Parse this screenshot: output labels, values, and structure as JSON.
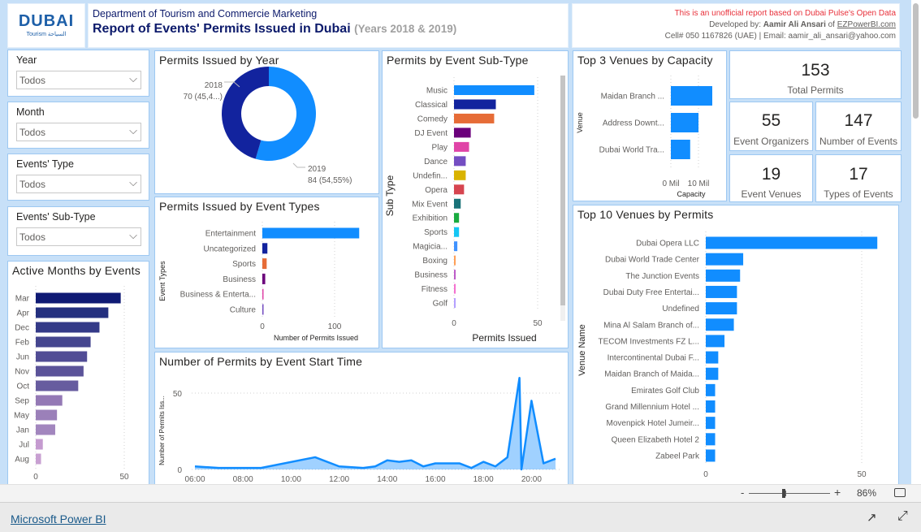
{
  "header": {
    "logo_text": "DUBAI",
    "logo_sub": "Tourism السياحة",
    "department": "Department of Tourism and Commercie Marketing",
    "title": "Report of Events' Permits Issued in Dubai",
    "years": "(Years 2018 & 2019)",
    "disclaimer": "This is an unofficial report based on Dubai Pulse's Open Data",
    "developed_prefix": "Developed by: ",
    "developer": "Aamir Ali Ansari",
    "of_text": " of ",
    "site": "EZPowerBI.com",
    "contact": "Cell# 050 1167826 (UAE) | Email: aamir_ali_ansari@yahoo.com"
  },
  "slicers": [
    {
      "label": "Year",
      "value": "Todos"
    },
    {
      "label": "Month",
      "value": "Todos"
    },
    {
      "label": "Events' Type",
      "value": "Todos"
    },
    {
      "label": "Events' Sub-Type",
      "value": "Todos"
    }
  ],
  "kpis": [
    {
      "value": "153",
      "label": "Total Permits"
    },
    {
      "value": "55",
      "label": "Event Organizers"
    },
    {
      "value": "147",
      "label": "Number of Events"
    },
    {
      "value": "19",
      "label": "Event Venues"
    },
    {
      "value": "17",
      "label": "Types of Events"
    }
  ],
  "chart_data": [
    {
      "id": "months",
      "type": "bar",
      "orientation": "horizontal",
      "title": "Active Months by Events",
      "categories": [
        "Mar",
        "Apr",
        "Dec",
        "Feb",
        "Jun",
        "Nov",
        "Oct",
        "Sep",
        "May",
        "Jan",
        "Jul",
        "Aug"
      ],
      "values": [
        48,
        41,
        36,
        31,
        29,
        27,
        24,
        15,
        12,
        11,
        4,
        3
      ],
      "colors": [
        "#0f1a74",
        "#24307f",
        "#343a88",
        "#45468f",
        "#514c95",
        "#5b5399",
        "#675c9f",
        "#9479b5",
        "#9b80b9",
        "#a286be",
        "#c59bd0",
        "#c8a0d2"
      ],
      "xticks": [
        "0",
        "50"
      ],
      "xlim": [
        0,
        50
      ],
      "xlabel": "",
      "ylabel": "",
      "grid": true
    },
    {
      "id": "year",
      "type": "pie",
      "donut": true,
      "title": "Permits Issued by Year",
      "categories": [
        "2018",
        "2019"
      ],
      "values": [
        70,
        84
      ],
      "labels": [
        "70 (45,4...)",
        "84 (54,55%)"
      ],
      "colors": [
        "#12239e",
        "#118dff"
      ]
    },
    {
      "id": "types",
      "type": "bar",
      "orientation": "horizontal",
      "title": "Permits Issued by Event Types",
      "categories": [
        "Entertainment",
        "Uncategorized",
        "Sports",
        "Business",
        "Business & Enterta...",
        "Culture"
      ],
      "values": [
        134,
        7,
        6,
        4,
        1,
        1
      ],
      "colors": [
        "#118dff",
        "#12239e",
        "#e66c37",
        "#6b007b",
        "#e044a7",
        "#744ec2"
      ],
      "xticks": [
        "0",
        "100"
      ],
      "xlim": [
        0,
        100
      ],
      "xlabel": "Number of Permits Issued",
      "ylabel": "Event Types",
      "grid": true
    },
    {
      "id": "subtypes",
      "type": "bar",
      "orientation": "horizontal",
      "title": "Permits by Event Sub-Type",
      "categories": [
        "Music",
        "Classical",
        "Comedy",
        "DJ Event",
        "Play",
        "Dance",
        "Undefin...",
        "Opera",
        "Mix Event",
        "Exhibition",
        "Sports",
        "Magicia...",
        "Boxing",
        "Business",
        "Fitness",
        "Golf"
      ],
      "values": [
        48,
        25,
        24,
        10,
        9,
        7,
        7,
        6,
        4,
        3,
        3,
        2,
        1,
        1,
        1,
        1
      ],
      "colors": [
        "#118dff",
        "#12239e",
        "#e66c37",
        "#6b007b",
        "#e044a7",
        "#744ec2",
        "#d9b300",
        "#d64550",
        "#197278",
        "#1aab40",
        "#15c6f4",
        "#4092ff",
        "#ffa058",
        "#be5dc9",
        "#f472d0",
        "#b5a1ff"
      ],
      "xticks": [
        "0",
        "50"
      ],
      "xlim": [
        0,
        50
      ],
      "xlabel": "Permits Issued",
      "ylabel": "Sub Type",
      "grid": true
    },
    {
      "id": "starttime",
      "type": "area",
      "title": "Number of Permits by Event Start Time",
      "x": [
        "06:00",
        "07:00",
        "08:00",
        "08:45",
        "11:00",
        "12:00",
        "13:00",
        "13:30",
        "14:00",
        "14:30",
        "15:00",
        "15:30",
        "16:00",
        "17:00",
        "17:30",
        "18:00",
        "18:30",
        "19:00",
        "19:30",
        "19:35",
        "20:00",
        "20:30",
        "21:00"
      ],
      "values": [
        2,
        1,
        1,
        1,
        8,
        2,
        1,
        2,
        6,
        5,
        6,
        2,
        4,
        4,
        1,
        5,
        2,
        8,
        60,
        0,
        45,
        4,
        7
      ],
      "xticks": [
        "06:00",
        "08:00",
        "10:00",
        "12:00",
        "14:00",
        "16:00",
        "18:00",
        "20:00"
      ],
      "yticks": [
        "0",
        "50"
      ],
      "ylim": [
        0,
        50
      ],
      "xlabel": "",
      "ylabel": "Number of Permits Iss...",
      "color": "#118dff",
      "grid": true
    },
    {
      "id": "capacity",
      "type": "bar",
      "orientation": "horizontal",
      "title": "Top 3 Venues by Capacity",
      "categories": [
        "Maidan Branch ...",
        "Address Downt...",
        "Dubai World Tra..."
      ],
      "values": [
        15,
        10,
        7
      ],
      "unit": "Mil",
      "colors": [
        "#118dff",
        "#118dff",
        "#118dff"
      ],
      "xticks": [
        "0 Mil",
        "10 Mil"
      ],
      "xlim": [
        0,
        10
      ],
      "xlabel": "Capacity",
      "ylabel": "Venue",
      "grid": true
    },
    {
      "id": "venues",
      "type": "bar",
      "orientation": "horizontal",
      "title": "Top 10 Venues by Permits",
      "categories": [
        "Dubai Opera LLC",
        "Dubai World Trade Center",
        "The Junction Events",
        "Dubai Duty Free Entertai...",
        "Undefined",
        "Mina Al Salam Branch of...",
        "TECOM Investments FZ L...",
        "Intercontinental Dubai F...",
        "Maidan Branch of Maida...",
        "Emirates Golf Club",
        "Grand Millennium Hotel ...",
        "Movenpick Hotel Jumeir...",
        "Queen Elizabeth Hotel 2",
        "Zabeel Park"
      ],
      "values": [
        55,
        12,
        11,
        10,
        10,
        9,
        6,
        4,
        4,
        3,
        3,
        3,
        3,
        3
      ],
      "colors": [
        "#118dff"
      ],
      "xticks": [
        "0",
        "50"
      ],
      "xlim": [
        0,
        50
      ],
      "xlabel": "",
      "ylabel": "Venue Name",
      "grid": true
    }
  ],
  "footer": {
    "zoom_minus": "-",
    "zoom_plus": "+",
    "zoom_level": "86%",
    "zoom_fraction": 0.43,
    "brand": "Microsoft Power BI"
  }
}
